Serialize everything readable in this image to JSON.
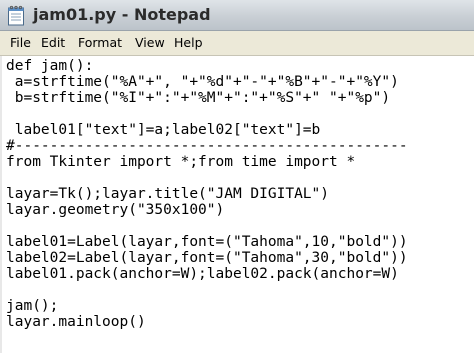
{
  "window": {
    "title": "jam01.py - Notepad",
    "app_icon": "notepad-icon"
  },
  "menu": {
    "items": [
      {
        "label": "File"
      },
      {
        "label": "Edit"
      },
      {
        "label": "Format"
      },
      {
        "label": "View"
      },
      {
        "label": "Help"
      }
    ]
  },
  "editor": {
    "lines": [
      "def jam():",
      " a=strftime(\"%A\"+\", \"+\"%d\"+\"-\"+\"%B\"+\"-\"+\"%Y\")",
      " b=strftime(\"%I\"+\":\"+\"%M\"+\":\"+\"%S\"+\" \"+\"%p\")",
      "",
      " label01[\"text\"]=a;label02[\"text\"]=b",
      "#---------------------------------------------",
      "from Tkinter import *;from time import *",
      "",
      "layar=Tk();layar.title(\"JAM DIGITAL\")",
      "layar.geometry(\"350x100\")",
      "",
      "label01=Label(layar,font=(\"Tahoma\",10,\"bold\"))",
      "label02=Label(layar,font=(\"Tahoma\",30,\"bold\"))",
      "label01.pack(anchor=W);label02.pack(anchor=W)",
      "",
      "jam();",
      "layar.mainloop()"
    ]
  }
}
